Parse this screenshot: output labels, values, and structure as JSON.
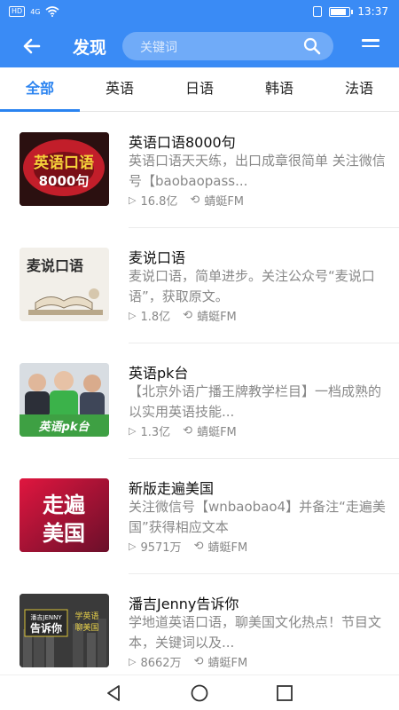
{
  "status_bar": {
    "sim_tag": "HD",
    "network": "4G",
    "time": "13:37",
    "battery_level": 0.85
  },
  "header": {
    "back_icon": "arrow-left-icon",
    "title": "发现",
    "search_placeholder": "关键词",
    "search_icon": "search-icon",
    "menu_icon": "menu-icon"
  },
  "tabs": [
    {
      "label": "全部",
      "active": true
    },
    {
      "label": "英语",
      "active": false
    },
    {
      "label": "日语",
      "active": false
    },
    {
      "label": "韩语",
      "active": false
    },
    {
      "label": "法语",
      "active": false
    }
  ],
  "accent_color": "#3a8bf5",
  "items": [
    {
      "title": "英语口语8000句",
      "description": "英语口语天天练，出口成章很简单 关注微信号【baobaopass...",
      "plays": "16.8亿",
      "source": "蜻蜓FM",
      "thumb_text_1": "英语口语",
      "thumb_text_2": "8000句"
    },
    {
      "title": "麦说口语",
      "description": "麦说口语，简单进步。关注公众号“麦说口语”，获取原文。",
      "plays": "1.8亿",
      "source": "蜻蜓FM",
      "thumb_text_1": "麦说口语"
    },
    {
      "title": "英语pk台",
      "description": "【北京外语广播王牌教学栏目】一档成熟的以实用英语技能...",
      "plays": "1.3亿",
      "source": "蜻蜓FM",
      "thumb_text_1": "英语pk台"
    },
    {
      "title": "新版走遍美国",
      "description": "关注微信号【wnbaobao4】并备注“走遍美国”获得相应文本",
      "plays": "9571万",
      "source": "蜻蜓FM",
      "thumb_text_1": "走遍",
      "thumb_text_2": "美国"
    },
    {
      "title": "潘吉Jenny告诉你",
      "description": "学地道英语口语，聊美国文化热点！节目文本，关键词以及...",
      "plays": "8662万",
      "source": "蜻蜓FM",
      "thumb_text_1": "潘吉JENNY",
      "thumb_text_2": "告诉你",
      "thumb_text_3": "学英语",
      "thumb_text_4": "聊美国"
    }
  ]
}
